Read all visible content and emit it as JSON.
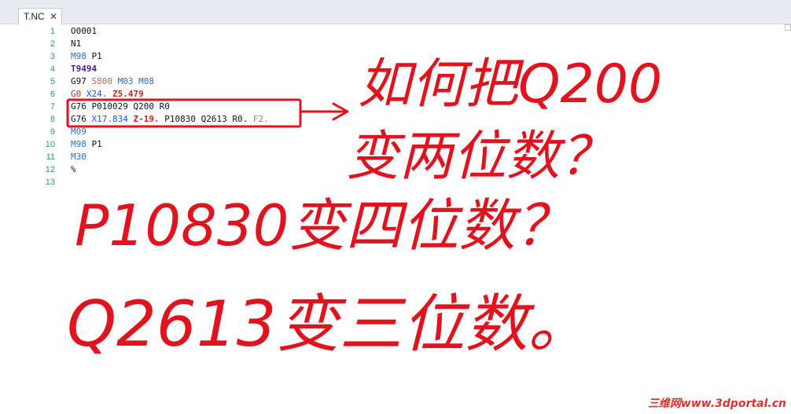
{
  "tab": {
    "label": "T.NC",
    "close_glyph": "✕"
  },
  "colors": {
    "default": "#111111",
    "m_code": "#2f6fb8",
    "t_code": "#4b1b8c",
    "s_code": "#b06a6a",
    "x_coord": "#1f56d6",
    "z_coord": "#d42020",
    "feed": "#c87050",
    "annotation_red": "#e0141e"
  },
  "lines": [
    {
      "num": "1",
      "tokens": [
        {
          "t": "O0001",
          "c": "default"
        }
      ]
    },
    {
      "num": "2",
      "tokens": [
        {
          "t": "N1",
          "c": "default"
        }
      ]
    },
    {
      "num": "3",
      "tokens": [
        {
          "t": "M98",
          "c": "m_code"
        },
        {
          "t": " P1",
          "c": "default"
        }
      ]
    },
    {
      "num": "4",
      "tokens": [
        {
          "t": "T9494",
          "c": "t_code",
          "b": true
        }
      ]
    },
    {
      "num": "5",
      "tokens": [
        {
          "t": "G97 ",
          "c": "default"
        },
        {
          "t": "S800",
          "c": "s_code"
        },
        {
          "t": " M03 M08",
          "c": "m_code"
        }
      ]
    },
    {
      "num": "6",
      "tokens": [
        {
          "t": "G0 ",
          "c": "z_coord"
        },
        {
          "t": "X24.",
          "c": "x_coord"
        },
        {
          "t": " Z5.479",
          "c": "z_coord",
          "b": true
        }
      ]
    },
    {
      "num": "7",
      "tokens": [
        {
          "t": "G76 P010029 Q200 R0",
          "c": "default"
        }
      ]
    },
    {
      "num": "8",
      "tokens": [
        {
          "t": "G76 ",
          "c": "default"
        },
        {
          "t": "X17.834",
          "c": "x_coord"
        },
        {
          "t": " Z-19.",
          "c": "z_coord",
          "b": true
        },
        {
          "t": " P10830 Q2613 R0. ",
          "c": "default"
        },
        {
          "t": "F2.",
          "c": "feed"
        }
      ]
    },
    {
      "num": "9",
      "tokens": [
        {
          "t": "M09",
          "c": "m_code"
        }
      ]
    },
    {
      "num": "10",
      "tokens": [
        {
          "t": "M98",
          "c": "m_code"
        },
        {
          "t": " P1",
          "c": "default"
        }
      ]
    },
    {
      "num": "11",
      "tokens": [
        {
          "t": "M30",
          "c": "m_code"
        }
      ]
    },
    {
      "num": "12",
      "tokens": [
        {
          "t": "%",
          "c": "default"
        }
      ]
    },
    {
      "num": "13",
      "tokens": []
    }
  ],
  "annotations": {
    "line1": "如何把Q200",
    "line2": "变两位数？",
    "line3": "P10830变四位数？",
    "line4": "Q2613变三位数。"
  },
  "watermark": "三维网www.3dportal.cn"
}
